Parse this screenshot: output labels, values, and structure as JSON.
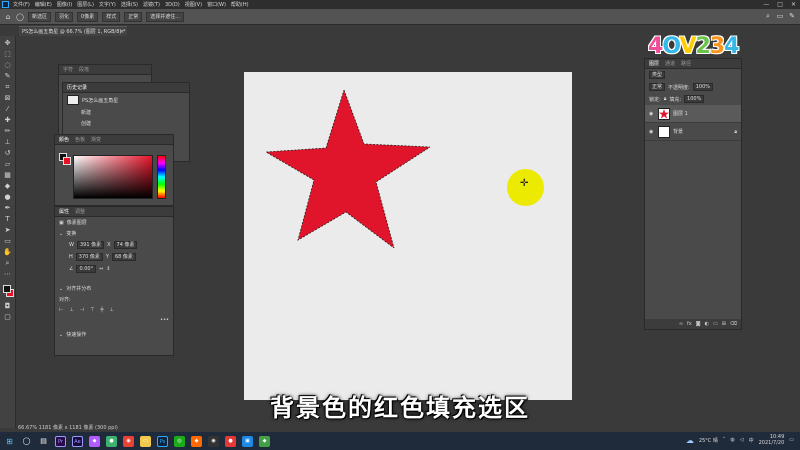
{
  "menubar": {
    "items": [
      "文件(F)",
      "编辑(E)",
      "图像(I)",
      "图层(L)",
      "文字(Y)",
      "选择(S)",
      "滤镜(T)",
      "3D(D)",
      "视图(V)",
      "窗口(W)",
      "帮助(H)"
    ],
    "window_controls": [
      "—",
      "□",
      "✕"
    ]
  },
  "optionsbar": {
    "mode": "新选区",
    "feather": "羽化",
    "feather_value": "0像素",
    "style": "样式",
    "style_value": "正常",
    "select_subject": "选择并遮住...",
    "right_label": "✎"
  },
  "document": {
    "tab_title": "PS怎么画五角星 @ 66.7% (图层 1, RGB/8) *",
    "close": "×"
  },
  "history_panel": {
    "tabs": [
      "字符",
      "段落"
    ],
    "sub_tab": "历史记录",
    "entries": [
      "PS怎么画五角星",
      "新建",
      "创建"
    ]
  },
  "color_panel": {
    "tabs": [
      "颜色",
      "色板",
      "渐变"
    ],
    "fg": "#111111",
    "bg": "#e81123"
  },
  "properties_panel": {
    "tabs": [
      "属性",
      "调整"
    ],
    "layer_kind": "像素图层",
    "section_transform": "变换",
    "w_label": "W",
    "w_value": "391 像素",
    "x_label": "X",
    "x_value": "74 像素",
    "h_label": "H",
    "h_value": "370 像素",
    "y_label": "Y",
    "y_value": "68 像素",
    "angle_value": "0.00°",
    "section_align": "对齐并分布",
    "align_label": "对齐:",
    "more": "•••",
    "section_quick": "快速操作"
  },
  "layers_panel": {
    "tabs": [
      "图层",
      "通道",
      "路径"
    ],
    "kind_label": "类型",
    "blend_mode": "正常",
    "opacity_label": "不透明度:",
    "opacity_value": "100%",
    "lock_label": "锁定:",
    "fill_label": "填充:",
    "fill_value": "100%",
    "layers": [
      {
        "name": "图层 1",
        "selected": true
      },
      {
        "name": "背景",
        "selected": false
      }
    ],
    "footer_icons": [
      "link-icon",
      "fx-icon",
      "mask-icon",
      "adjust-icon",
      "folder-icon",
      "new-layer-icon",
      "trash-icon"
    ]
  },
  "logo": {
    "chars": [
      "4",
      "O",
      "V",
      "2",
      "3",
      "4"
    ],
    "colors": [
      "#f04e98",
      "#35b7e8",
      "#ffcc00",
      "#6cc24a",
      "#f7941d",
      "#35b7e8"
    ]
  },
  "subtitle": "背景色的红色填充选区",
  "status": {
    "zoom": "66.67%",
    "doc_size": "1181 像素 x 1181 像素 (300 ppi)"
  },
  "taskbar": {
    "weather": "25°C 晴",
    "ime": "中",
    "time": "10:49",
    "date": "2021/7/20"
  },
  "colors": {
    "star": "#e0142a",
    "cursor_highlight": "#ecea00",
    "canvas": "#ebebeb"
  }
}
